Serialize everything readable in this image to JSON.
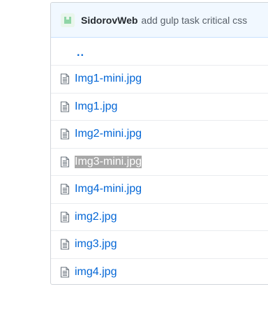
{
  "commit": {
    "author": "SidorovWeb",
    "message": "add gulp task critical css"
  },
  "parent_link": "..",
  "files": [
    {
      "name": "Img1-mini.jpg",
      "selected": false
    },
    {
      "name": "Img1.jpg",
      "selected": false
    },
    {
      "name": "Img2-mini.jpg",
      "selected": false
    },
    {
      "name": "Img3-mini.jpg",
      "selected": true
    },
    {
      "name": "Img4-mini.jpg",
      "selected": false
    },
    {
      "name": "img2.jpg",
      "selected": false
    },
    {
      "name": "img3.jpg",
      "selected": false
    },
    {
      "name": "img4.jpg",
      "selected": false
    }
  ],
  "icons": {
    "avatar": "identicon-avatar",
    "file": "file-icon"
  },
  "colors": {
    "link": "#0366d6",
    "commit_bar_bg": "#f1f8ff",
    "selection_bg": "#a8a8a8"
  }
}
